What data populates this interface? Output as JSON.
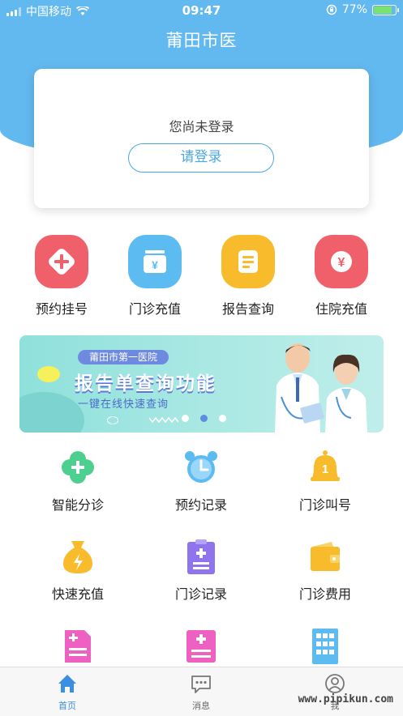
{
  "status_bar": {
    "carrier": "中国移动",
    "time": "09:47",
    "battery_percent": "77%"
  },
  "header": {
    "title": "莆田市医"
  },
  "login": {
    "prompt": "您尚未登录",
    "button_label": "请登录"
  },
  "quick_services": [
    {
      "label": "预约挂号",
      "icon": "plus-diamond-icon",
      "color": "#f0606a"
    },
    {
      "label": "门诊充值",
      "icon": "yuan-card-icon",
      "color": "#5cbcf2"
    },
    {
      "label": "报告查询",
      "icon": "report-icon",
      "color": "#f8bb2c"
    },
    {
      "label": "住院充值",
      "icon": "yuan-circle-icon",
      "color": "#f0606a"
    }
  ],
  "banner": {
    "hospital": "莆田市第一医院",
    "title": "报告单查询功能",
    "subtitle": "一键在线快速查询"
  },
  "services": [
    {
      "label": "智能分诊",
      "icon": "clover-cross-icon",
      "color": "#4ccf8f"
    },
    {
      "label": "预约记录",
      "icon": "alarm-clock-icon",
      "color": "#5cbcf2"
    },
    {
      "label": "门诊叫号",
      "icon": "bell-icon",
      "color": "#f8bb2c"
    },
    {
      "label": "快速充值",
      "icon": "money-bag-icon",
      "color": "#f8bb2c"
    },
    {
      "label": "门诊记录",
      "icon": "clipboard-icon",
      "color": "#8f74ee"
    },
    {
      "label": "门诊费用",
      "icon": "wallet-icon",
      "color": "#f8bb2c"
    },
    {
      "label": "",
      "icon": "document-plus-icon",
      "color": "#ee60c2"
    },
    {
      "label": "",
      "icon": "calculator-icon",
      "color": "#ee60c2"
    },
    {
      "label": "",
      "icon": "building-icon",
      "color": "#5cbcf2"
    }
  ],
  "tabbar": {
    "home": "首页",
    "messages": "消息",
    "me": "我"
  },
  "watermark": "www.pipikun.com"
}
